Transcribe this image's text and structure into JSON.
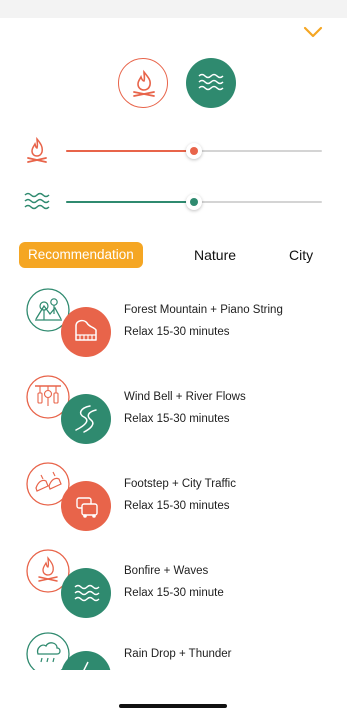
{
  "colors": {
    "fire": "#e8644a",
    "water": "#2f8a6f",
    "accent": "#f5a623"
  },
  "mixer": {
    "fire_icon": "bonfire-icon",
    "waves_icon": "waves-icon",
    "fire_level": 0.5,
    "waves_level": 0.5
  },
  "tabs": [
    {
      "label": "Recommendation",
      "active": true
    },
    {
      "label": "Nature",
      "active": false
    },
    {
      "label": "City",
      "active": false
    }
  ],
  "items": [
    {
      "title": "Forest Mountain + Piano String",
      "subtitle": "Relax 15-30 minutes",
      "icons": [
        "forest-mountain-icon",
        "piano-icon"
      ]
    },
    {
      "title": "Wind Bell + River Flows",
      "subtitle": "Relax 15-30 minutes",
      "icons": [
        "wind-bell-icon",
        "river-icon"
      ]
    },
    {
      "title": "Footstep + City Traffic",
      "subtitle": "Relax 15-30 minutes",
      "icons": [
        "footstep-icon",
        "traffic-icon"
      ]
    },
    {
      "title": "Bonfire + Waves",
      "subtitle": "Relax 15-30 minute",
      "icons": [
        "bonfire-icon",
        "waves-icon"
      ]
    },
    {
      "title": "Rain Drop + Thunder",
      "subtitle": "",
      "icons": [
        "rain-drop-icon",
        "thunder-icon"
      ]
    }
  ]
}
